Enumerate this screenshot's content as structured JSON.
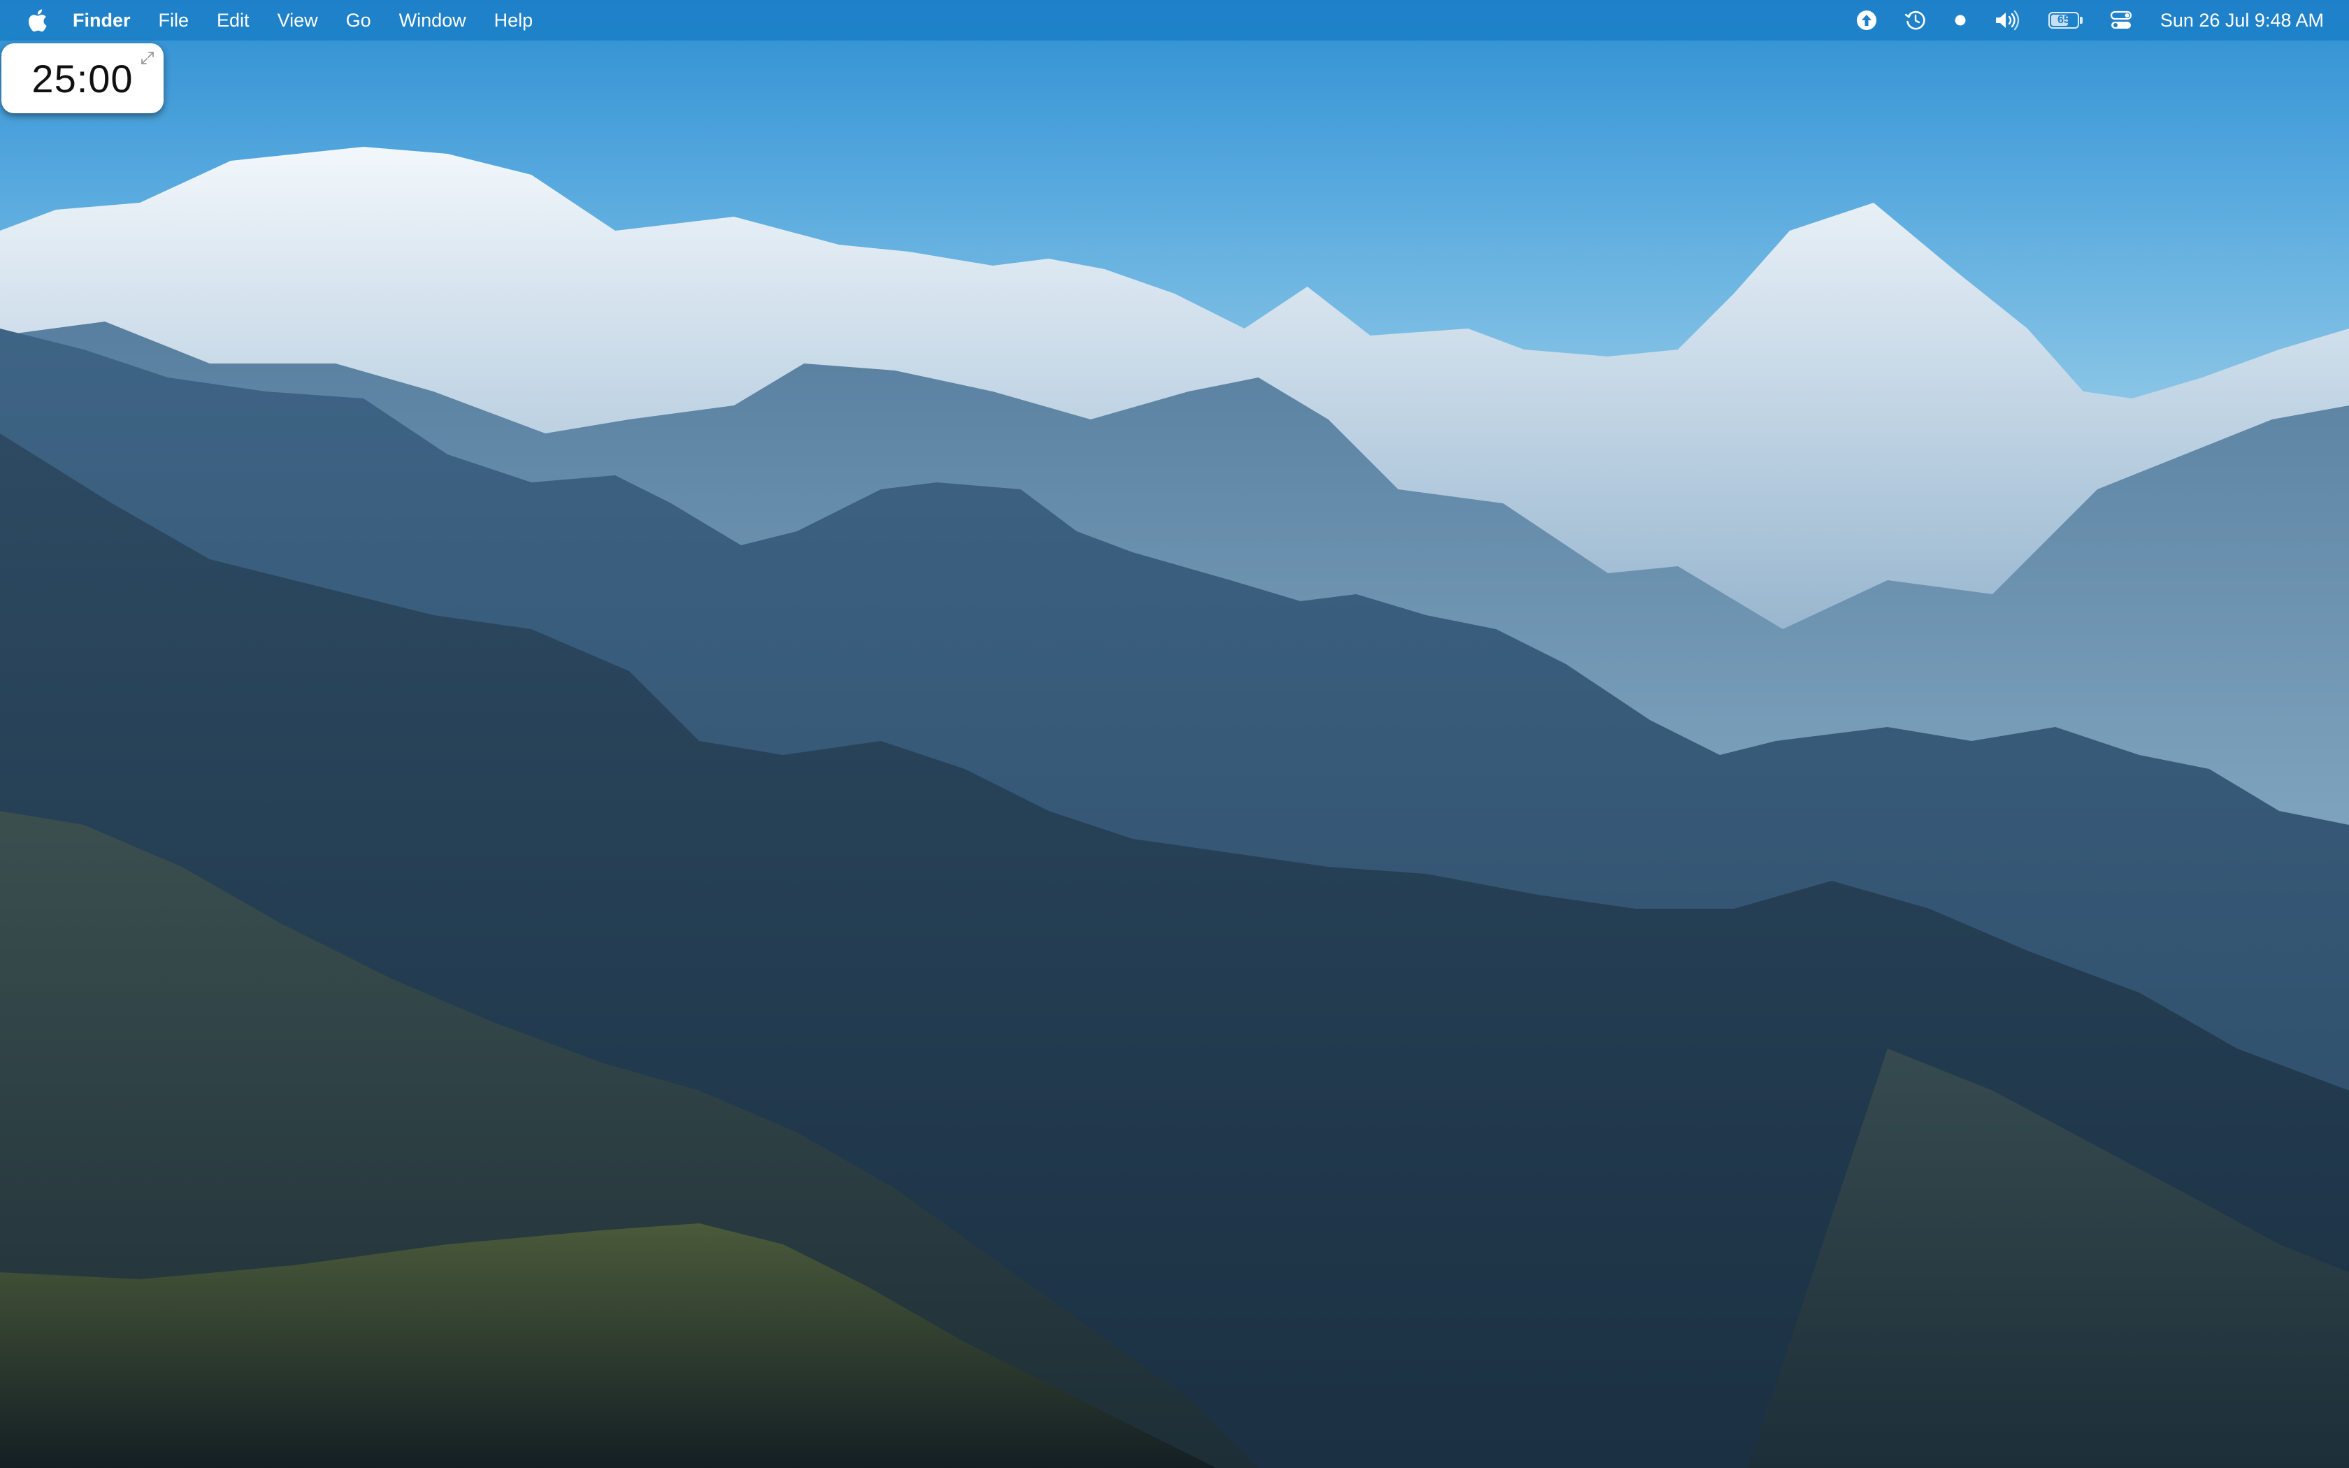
{
  "menubar": {
    "apple_icon": "apple-logo-icon",
    "app_name": "Finder",
    "menus": [
      "File",
      "Edit",
      "View",
      "Go",
      "Window",
      "Help"
    ],
    "status_icons": [
      "upload-arrow-icon",
      "time-machine-icon",
      "dot-icon",
      "volume-icon",
      "battery-icon",
      "control-center-icon"
    ],
    "battery_level": "65",
    "battery_fraction": 0.65,
    "clock": "Sun 26 Jul  9:48 AM"
  },
  "timer_widget": {
    "value": "25:00",
    "expand_icon": "expand-arrows-icon"
  },
  "colors": {
    "menubar": "#1c80c8",
    "sky_top": "#2f8fd2",
    "widget_bg": "#ffffff"
  }
}
